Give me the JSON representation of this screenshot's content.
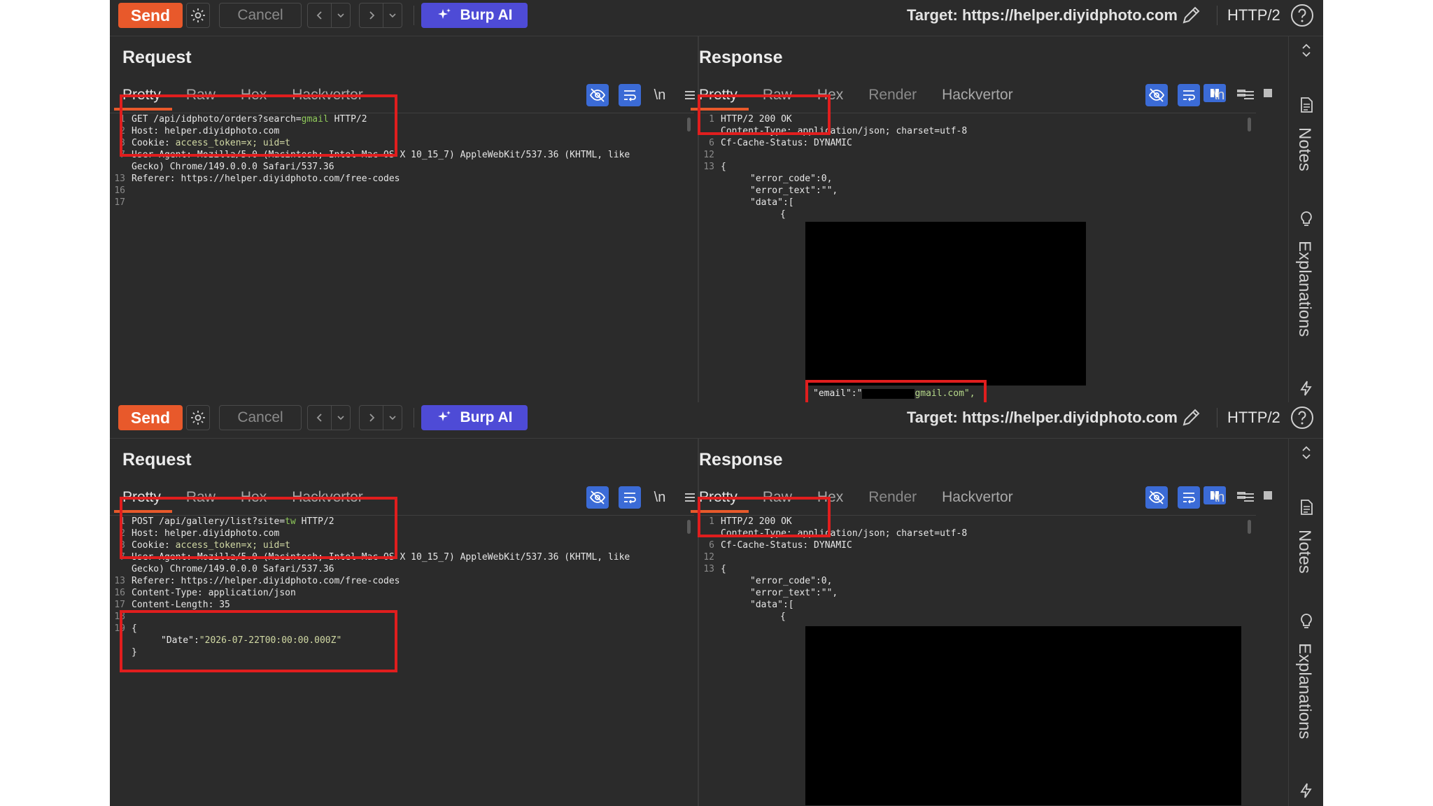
{
  "toolbar": {
    "send_label": "Send",
    "cancel_label": "Cancel",
    "burp_ai_label": "Burp AI",
    "target_label": "Target: https://helper.diyidphoto.com",
    "protocol": "HTTP/2"
  },
  "colors": {
    "send": "#e8592b",
    "burp_ai": "#4e4bd6",
    "highlight_box": "#e01e1e",
    "accent_blue": "#3b6bd6"
  },
  "request_title": "Request",
  "response_title": "Response",
  "request_tabs": [
    "Pretty",
    "Raw",
    "Hex",
    "Hackvertor"
  ],
  "response_tabs": [
    "Pretty",
    "Raw",
    "Hex",
    "Render",
    "Hackvertor"
  ],
  "newline_toggle": "\\n",
  "sidebar": {
    "notes": "Notes",
    "explanations": "Explanations"
  },
  "panel1": {
    "request": {
      "line1_method": "GET",
      "line1_path": " /api/idphoto/orders?search=",
      "line1_value": "gmail",
      "line1_proto": " HTTP/2",
      "host": "Host: helper.diyidphoto.com",
      "cookie_key": "Cookie: ",
      "cookie_val": "access_token=x; uid=t",
      "ua1": "User-Agent: Mozilla/5.0 (Macintosh; Intel Mac OS X 10_15_7) AppleWebKit/537.36 (KHTML, like",
      "ua2": "Gecko) Chrome/149.0.0.0 Safari/537.36",
      "referer": "Referer: https://helper.diyidphoto.com/free-codes",
      "gutter": [
        "1",
        "2",
        "3",
        "7",
        "",
        "13",
        "16",
        "17"
      ]
    },
    "response": {
      "status": "HTTP/2 200 OK",
      "content_type": "Content-Type: application/json; charset=utf-8",
      "cache": "Cf-Cache-Status: DYNAMIC",
      "brace_open": "{",
      "error_code": "\"error_code\":0,",
      "error_text": "\"error_text\":\"\",",
      "data": "\"data\":[",
      "obj_open": "{",
      "email_key": "\"email\":\"",
      "email_val": "gmail.com\",",
      "gutter": [
        "1",
        "",
        "6",
        "12",
        "13"
      ]
    }
  },
  "panel2": {
    "request": {
      "line1_method": "POST",
      "line1_path": " /api/gallery/list?site=",
      "line1_value": "tw",
      "line1_proto": " HTTP/2",
      "host": "Host: helper.diyidphoto.com",
      "cookie_key": "Cookie: ",
      "cookie_val": "access_token=x; uid=t",
      "ua1": "User-Agent: Mozilla/5.0 (Macintosh; Intel Mac OS X 10_15_7) AppleWebKit/537.36 (KHTML, like",
      "ua2": "Gecko) Chrome/149.0.0.0 Safari/537.36",
      "referer": "Referer: https://helper.diyidphoto.com/free-codes",
      "ctype": "Content-Type: application/json",
      "clen": "Content-Length: 35",
      "body_open": "{",
      "date_key": "\"Date\":",
      "date_val": "\"2026-07-22T00:00:00.000Z\"",
      "body_close": "}",
      "gutter": [
        "1",
        "2",
        "3",
        "7",
        "",
        "13",
        "16",
        "17",
        "18",
        "19"
      ]
    },
    "response": {
      "status": "HTTP/2 200 OK",
      "content_type": "Content-Type: application/json; charset=utf-8",
      "cache": "Cf-Cache-Status: DYNAMIC",
      "brace_open": "{",
      "error_code": "\"error_code\":0,",
      "error_text": "\"error_text\":\"\",",
      "data": "\"data\":[",
      "obj_open": "{",
      "obj_close": "}",
      "gutter": [
        "1",
        "",
        "6",
        "12",
        "13"
      ]
    }
  }
}
